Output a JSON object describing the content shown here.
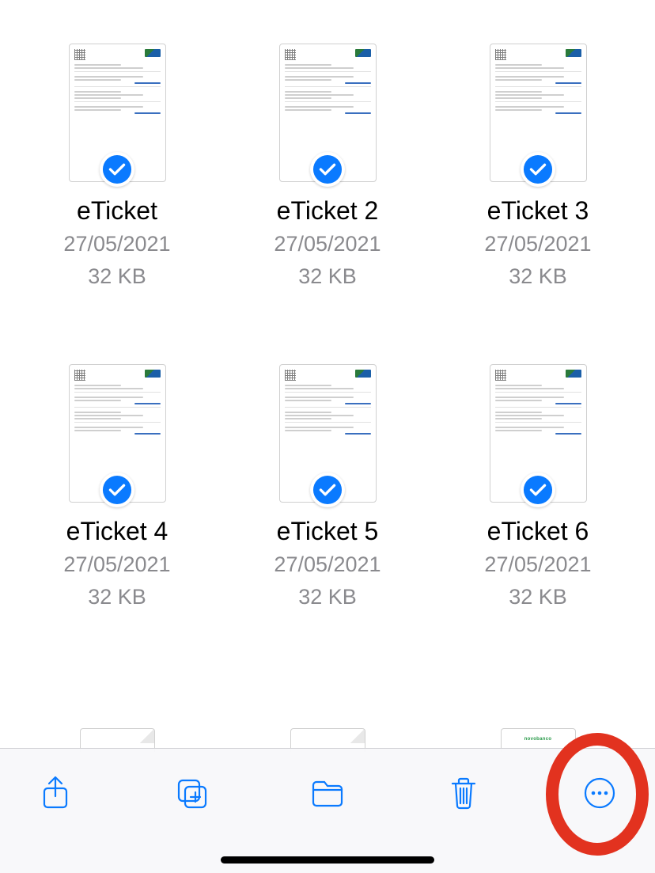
{
  "files": [
    {
      "name": "eTicket",
      "date": "27/05/2021",
      "size": "32 KB",
      "selected": true
    },
    {
      "name": "eTicket 2",
      "date": "27/05/2021",
      "size": "32 KB",
      "selected": true
    },
    {
      "name": "eTicket 3",
      "date": "27/05/2021",
      "size": "32 KB",
      "selected": true
    },
    {
      "name": "eTicket 4",
      "date": "27/05/2021",
      "size": "32 KB",
      "selected": true
    },
    {
      "name": "eTicket 5",
      "date": "27/05/2021",
      "size": "32 KB",
      "selected": true
    },
    {
      "name": "eTicket 6",
      "date": "27/05/2021",
      "size": "32 KB",
      "selected": true
    }
  ],
  "partial_files": [
    {
      "kind": "blank-fold"
    },
    {
      "kind": "blank-fold"
    },
    {
      "kind": "brand",
      "brand": "novobanco"
    }
  ],
  "toolbar": {
    "share": "Share",
    "duplicate": "Duplicate",
    "move": "Move",
    "delete": "Delete",
    "more": "More"
  },
  "colors": {
    "accent": "#0a7aff",
    "selected_check": "#0a7aff",
    "annotation": "#e2321f",
    "secondary_text": "#8a8a8e"
  }
}
